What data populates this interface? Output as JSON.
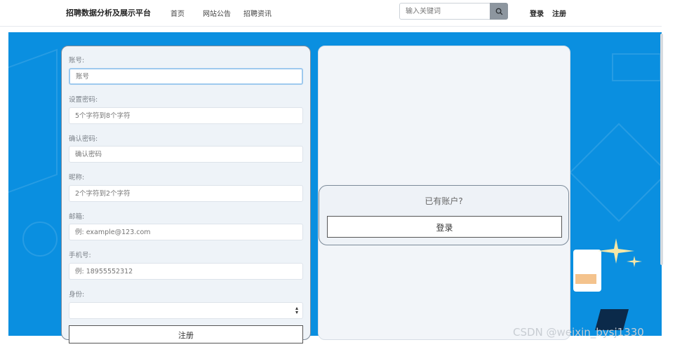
{
  "navbar": {
    "brand": "招聘数据分析及展示平台",
    "links": [
      "首页",
      "网站公告",
      "招聘资讯"
    ],
    "search_placeholder": "输入关键词",
    "login": "登录",
    "register": "注册"
  },
  "form": {
    "fields": [
      {
        "label": "账号:",
        "placeholder": "账号"
      },
      {
        "label": "设置密码:",
        "placeholder": "5个字符到8个字符"
      },
      {
        "label": "确认密码:",
        "placeholder": "确认密码"
      },
      {
        "label": "昵称:",
        "placeholder": "2个字符到2个字符"
      },
      {
        "label": "邮箱:",
        "placeholder": "例: example@123.com"
      },
      {
        "label": "手机号:",
        "placeholder": "例: 18955552312"
      },
      {
        "label": "身份:",
        "value": ""
      }
    ],
    "submit": "注册"
  },
  "login_card": {
    "prompt": "已有账户?",
    "button": "登录"
  },
  "watermark": "CSDN @weixin_bysj1330",
  "colors": {
    "banner": "#0a8fe0",
    "accent_star": "#f5e7a6"
  }
}
